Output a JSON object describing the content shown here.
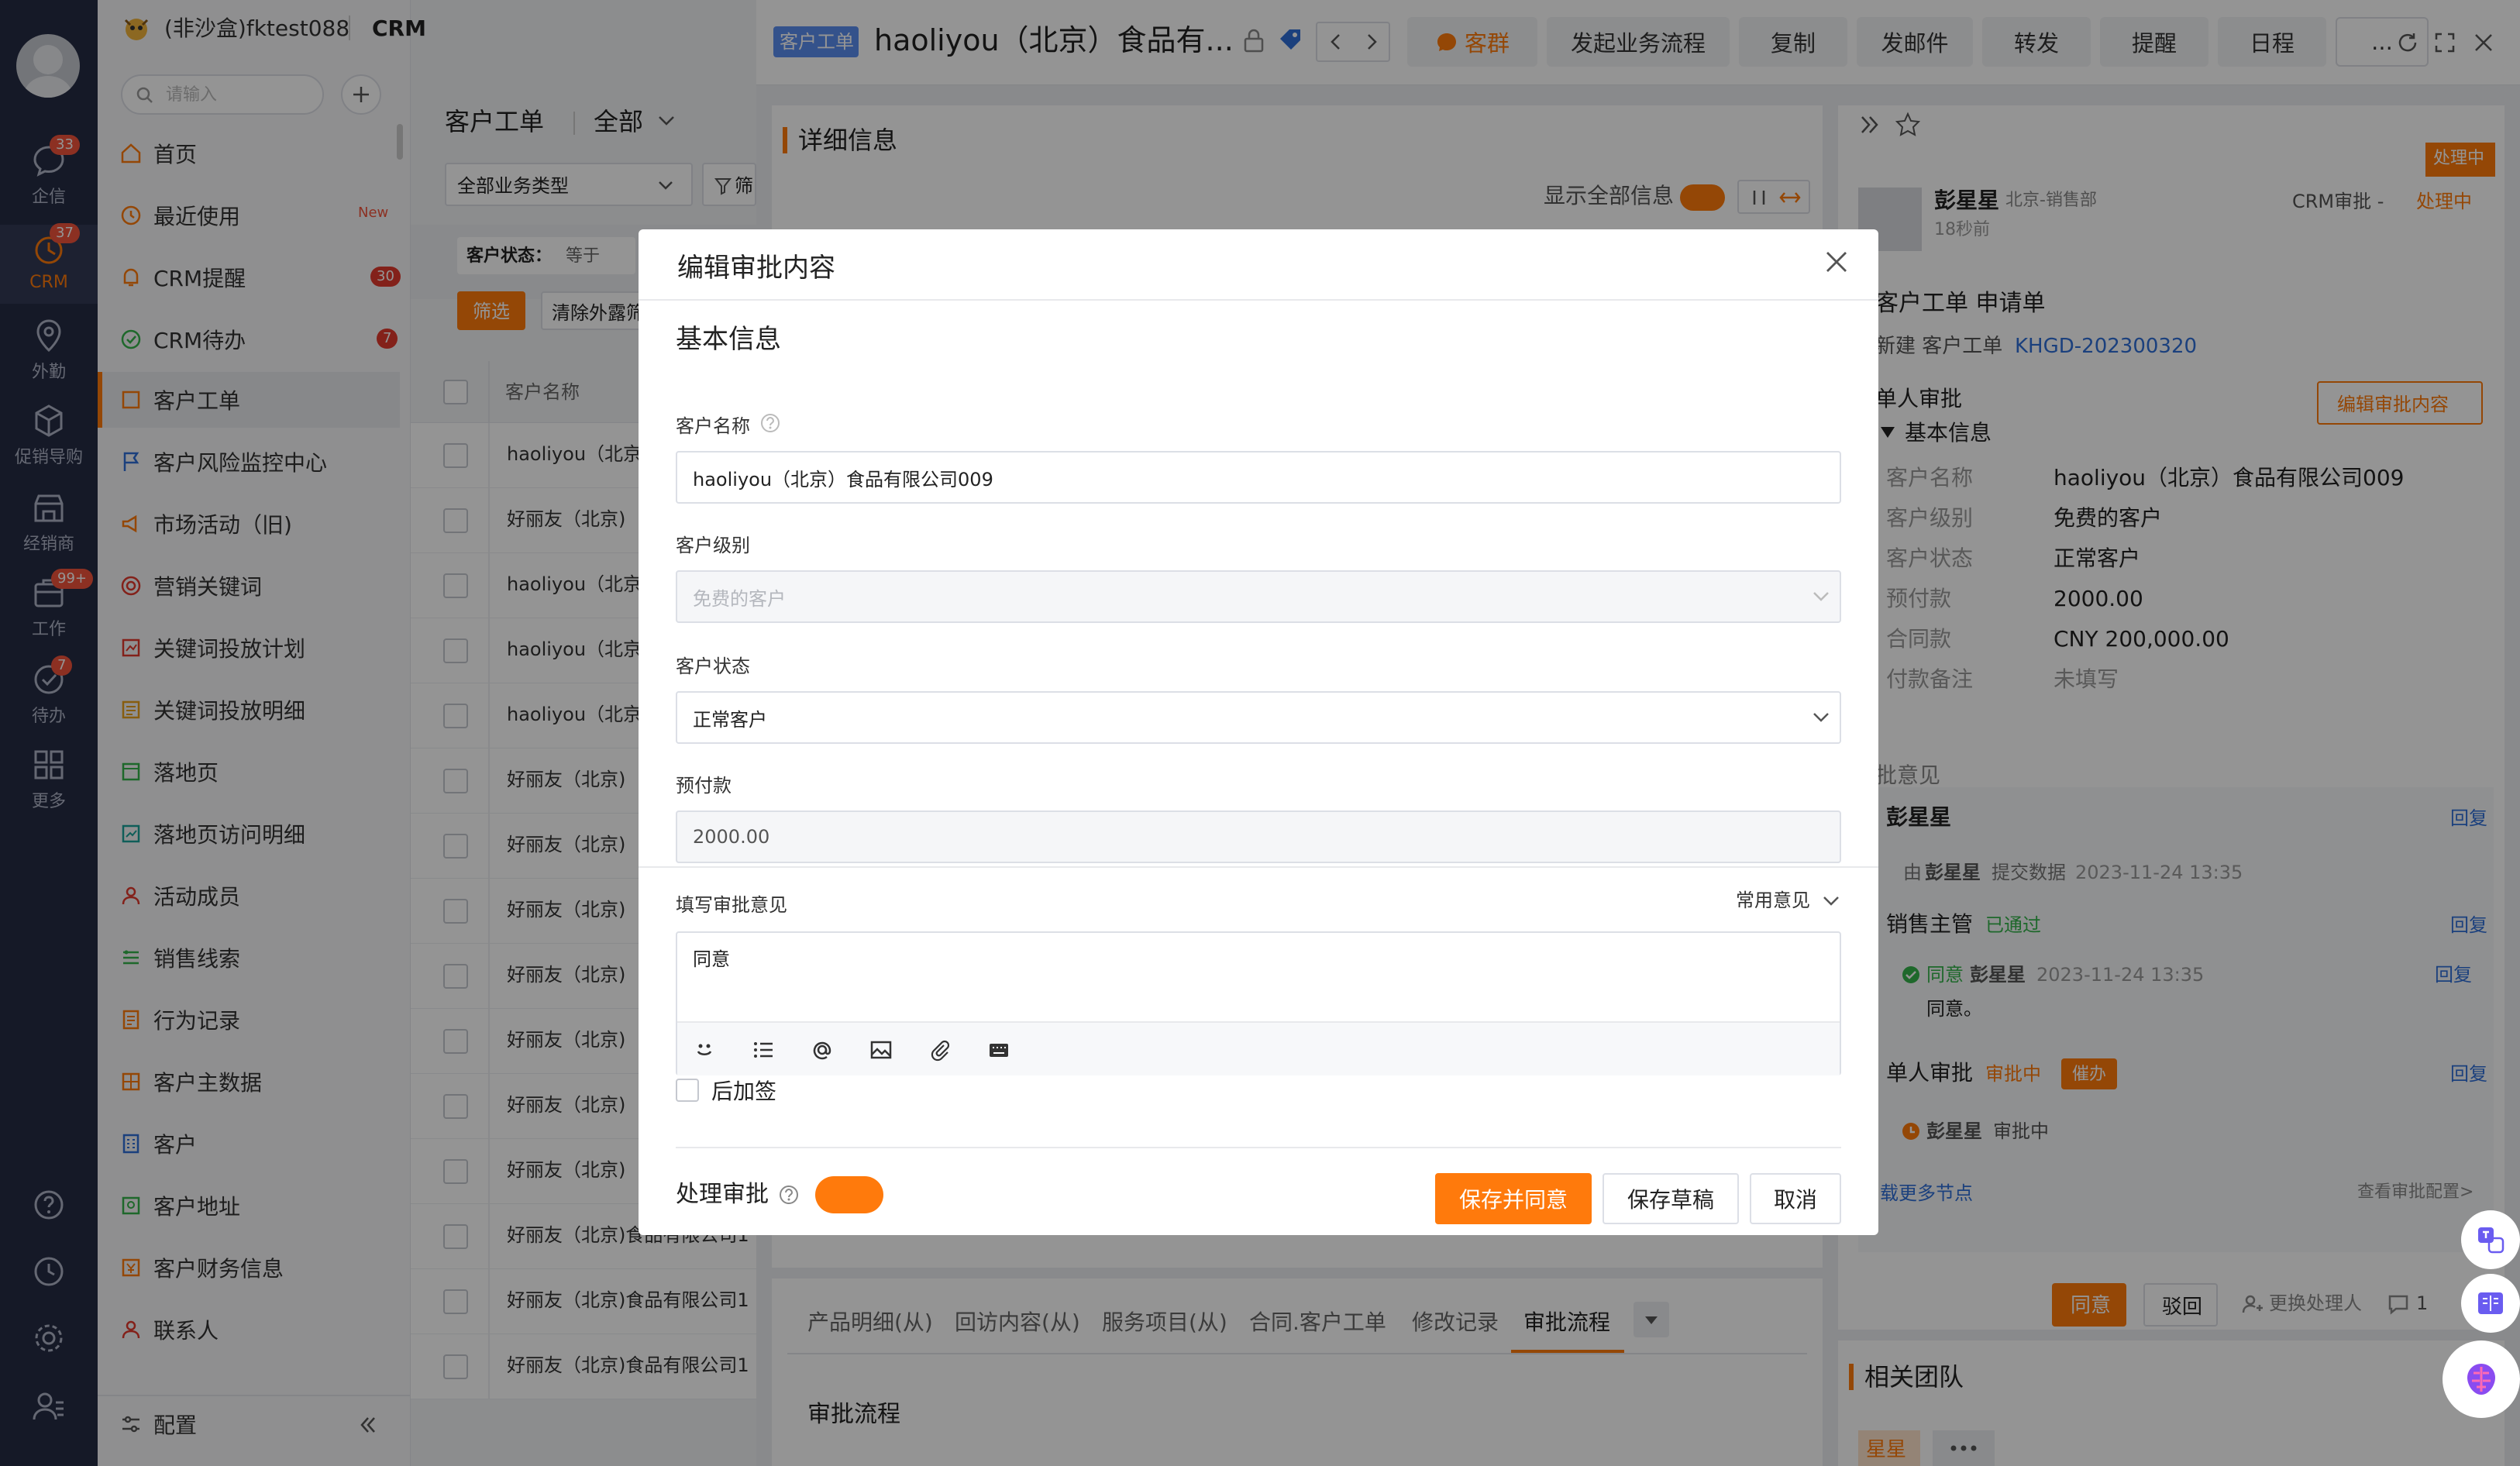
{
  "rail": {
    "items": [
      {
        "label": "企信",
        "badge": "33"
      },
      {
        "label": "CRM",
        "badge": "37"
      },
      {
        "label": "外勤",
        "badge": ""
      },
      {
        "label": "促销导购",
        "badge": ""
      },
      {
        "label": "经销商",
        "badge": ""
      },
      {
        "label": "工作",
        "badge": "99+"
      },
      {
        "label": "待办",
        "badge": "7"
      },
      {
        "label": "更多",
        "badge": ""
      }
    ]
  },
  "topbar": {
    "company": "(非沙盒)fktest088",
    "app": "CRM"
  },
  "menu": {
    "search_placeholder": "请输入",
    "new_label": "New",
    "items": [
      {
        "label": "首页",
        "badge": ""
      },
      {
        "label": "最近使用",
        "badge": ""
      },
      {
        "label": "CRM提醒",
        "badge": "30"
      },
      {
        "label": "CRM待办",
        "badge": "7"
      },
      {
        "label": "客户工单",
        "badge": ""
      },
      {
        "label": "客户风险监控中心",
        "badge": ""
      },
      {
        "label": "市场活动（旧)",
        "badge": ""
      },
      {
        "label": "营销关键词",
        "badge": ""
      },
      {
        "label": "关键词投放计划",
        "badge": ""
      },
      {
        "label": "关键词投放明细",
        "badge": ""
      },
      {
        "label": "落地页",
        "badge": ""
      },
      {
        "label": "落地页访问明细",
        "badge": ""
      },
      {
        "label": "活动成员",
        "badge": ""
      },
      {
        "label": "销售线索",
        "badge": ""
      },
      {
        "label": "行为记录",
        "badge": ""
      },
      {
        "label": "客户主数据",
        "badge": ""
      },
      {
        "label": "客户",
        "badge": ""
      },
      {
        "label": "客户地址",
        "badge": ""
      },
      {
        "label": "客户财务信息",
        "badge": ""
      },
      {
        "label": "联系人",
        "badge": ""
      }
    ],
    "config_label": "配置"
  },
  "list": {
    "title": "客户工单",
    "scope": "全部",
    "type_select": "全部业务类型",
    "filter_btn": "筛",
    "status_filter": "客户状态：",
    "status_op": "等于",
    "filter_tag": "筛选",
    "clear_btn": "清除外露筛",
    "col_header": "客户名称",
    "rows": [
      "haoliyou（北京)",
      "好丽友（北京)",
      "haoliyou（北京)",
      "haoliyou（北京)",
      "haoliyou（北京)",
      "好丽友（北京)",
      "好丽友（北京)",
      "好丽友（北京)",
      "好丽友（北京)",
      "好丽友（北京)",
      "好丽友（北京)",
      "好丽友（北京)",
      "好丽友（北京)食品有限公司1",
      "好丽友（北京)食品有限公司1",
      "好丽友（北京)食品有限公司1"
    ]
  },
  "detail": {
    "tag": "客户工单",
    "title": "haoliyou（北京）食品有...",
    "buttons": [
      "客群",
      "发起业务流程",
      "复制",
      "发邮件",
      "转发",
      "提醒",
      "日程",
      "..."
    ],
    "section_title": "详细信息",
    "show_all": "显示全部信息",
    "tabs": [
      "产品明细(从)",
      "回访内容(从)",
      "服务项目(从)",
      "合同.客户工单",
      "修改记录",
      "审批流程"
    ],
    "flow_title": "审批流程"
  },
  "approval": {
    "status_tag": "处理中",
    "user": "彭星星",
    "dept": "北京-销售部",
    "time_ago": "18秒前",
    "crm_label": "CRM审批 -",
    "crm_status": "处理中",
    "req_title": "客户工单 申请单",
    "new_label": "新建 客户工单",
    "code": "KHGD-202300320",
    "single": "单人审批",
    "edit_btn": "编辑审批内容",
    "basic": "基本信息",
    "fields": [
      {
        "k": "客户名称",
        "v": "haoliyou（北京）食品有限公司009"
      },
      {
        "k": "客户级别",
        "v": "免费的客户"
      },
      {
        "k": "客户状态",
        "v": "正常客户"
      },
      {
        "k": "预付款",
        "v": "2000.00"
      },
      {
        "k": "合同款",
        "v": "CNY 200,000.00"
      },
      {
        "k": "付款备注",
        "v": "未填写"
      }
    ],
    "opinion": "批意见",
    "reply": "回复",
    "submit_by": "由",
    "submit_user": "彭星星",
    "submit_text": "提交数据",
    "submit_time": "2023-11-24 13:35",
    "mgr": "销售主管",
    "passed": "已通过",
    "agree": "同意",
    "agree_time": "2023-11-24 13:35",
    "agree_text": "同意。",
    "single2": "单人审批",
    "in_progress": "审批中",
    "urge": "催办",
    "pending": "审批中",
    "more_nodes": "载更多节点",
    "view_config": "查看审批配置>",
    "btn_agree": "同意",
    "btn_reject": "驳回",
    "change_handler": "更换处理人",
    "comment_count": "1",
    "team": "相关团队",
    "team_member": "星星"
  },
  "modal": {
    "title": "编辑审批内容",
    "section": "基本信息",
    "name_label": "客户名称",
    "name_value": "haoliyou（北京）食品有限公司009",
    "level_label": "客户级别",
    "level_value": "免费的客户",
    "status_label": "客户状态",
    "status_value": "正常客户",
    "prepay_label": "预付款",
    "prepay_value": "2000.00",
    "opinion_label": "填写审批意见",
    "common_opinion": "常用意见",
    "opinion_value": "同意",
    "after_sign": "后加签",
    "process_label": "处理审批",
    "btn_save_agree": "保存并同意",
    "btn_draft": "保存草稿",
    "btn_cancel": "取消"
  }
}
